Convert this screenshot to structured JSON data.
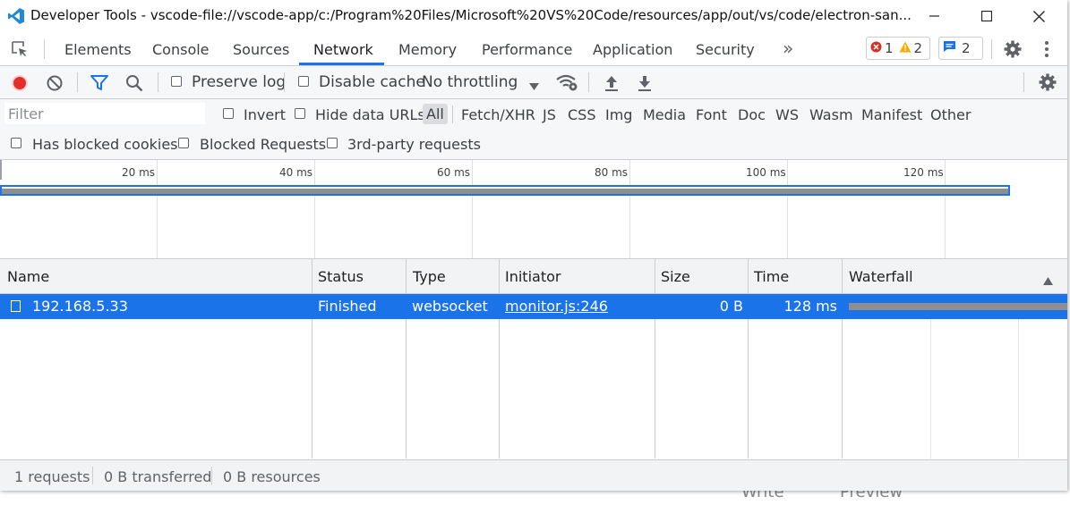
{
  "window": {
    "title": "Developer Tools - vscode-file://vscode-app/c:/Program%20Files/Microsoft%20VS%20Code/resources/app/out/vs/code/electron-san..."
  },
  "tabs": {
    "items": [
      "Elements",
      "Console",
      "Sources",
      "Network",
      "Memory",
      "Performance",
      "Application",
      "Security"
    ],
    "active": "Network",
    "more": "»"
  },
  "badges": {
    "errors": "1",
    "warnings": "2",
    "messages": "2"
  },
  "toolbar": {
    "preserve_log": "Preserve log",
    "disable_cache": "Disable cache",
    "throttling": "No throttling"
  },
  "filter": {
    "placeholder": "Filter",
    "invert": "Invert",
    "hide_data_urls": "Hide data URLs",
    "types": [
      "All",
      "Fetch/XHR",
      "JS",
      "CSS",
      "Img",
      "Media",
      "Font",
      "Doc",
      "WS",
      "Wasm",
      "Manifest",
      "Other"
    ],
    "selected_type": "All"
  },
  "blocked": {
    "has_blocked_cookies": "Has blocked cookies",
    "blocked_requests": "Blocked Requests",
    "third_party": "3rd-party requests"
  },
  "overview": {
    "ticks": [
      "20 ms",
      "40 ms",
      "60 ms",
      "80 ms",
      "100 ms",
      "120 ms"
    ]
  },
  "table": {
    "columns": [
      "Name",
      "Status",
      "Type",
      "Initiator",
      "Size",
      "Time",
      "Waterfall"
    ],
    "rows": [
      {
        "name": "192.168.5.33",
        "status": "Finished",
        "type": "websocket",
        "initiator": "monitor.js:246",
        "size": "0 B",
        "time": "128 ms"
      }
    ]
  },
  "status": {
    "requests": "1 requests",
    "transferred": "0 B transferred",
    "resources": "0 B resources"
  },
  "background": {
    "write": "Write",
    "preview": "Preview"
  },
  "colors": {
    "accent": "#1a73e8",
    "record": "#e52d2d",
    "error": "#d93025",
    "warning": "#f9ab00"
  }
}
